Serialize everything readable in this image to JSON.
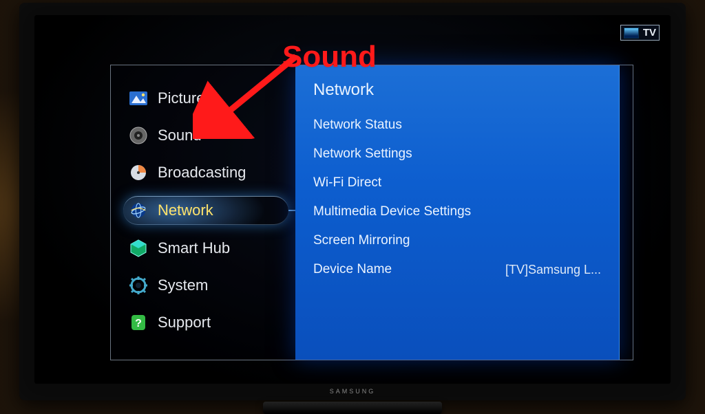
{
  "source_badge": {
    "label": "TV"
  },
  "categories": [
    {
      "id": "picture",
      "label": "Picture",
      "icon": "picture-icon"
    },
    {
      "id": "sound",
      "label": "Sound",
      "icon": "sound-icon"
    },
    {
      "id": "broadcasting",
      "label": "Broadcasting",
      "icon": "broadcasting-icon"
    },
    {
      "id": "network",
      "label": "Network",
      "icon": "network-icon",
      "selected": true
    },
    {
      "id": "smart-hub",
      "label": "Smart Hub",
      "icon": "smarthub-icon"
    },
    {
      "id": "system",
      "label": "System",
      "icon": "system-icon"
    },
    {
      "id": "support",
      "label": "Support",
      "icon": "support-icon"
    }
  ],
  "sub_panel": {
    "title": "Network",
    "items": [
      {
        "label": "Network Status",
        "value": ""
      },
      {
        "label": "Network Settings",
        "value": ""
      },
      {
        "label": "Wi-Fi Direct",
        "value": ""
      },
      {
        "label": "Multimedia Device Settings",
        "value": ""
      },
      {
        "label": "Screen Mirroring",
        "value": ""
      },
      {
        "label": "Device Name",
        "value": "[TV]Samsung L..."
      }
    ]
  },
  "annotation": {
    "label": "Sound",
    "target": "sound"
  },
  "tv_brand": "SAMSUNG"
}
